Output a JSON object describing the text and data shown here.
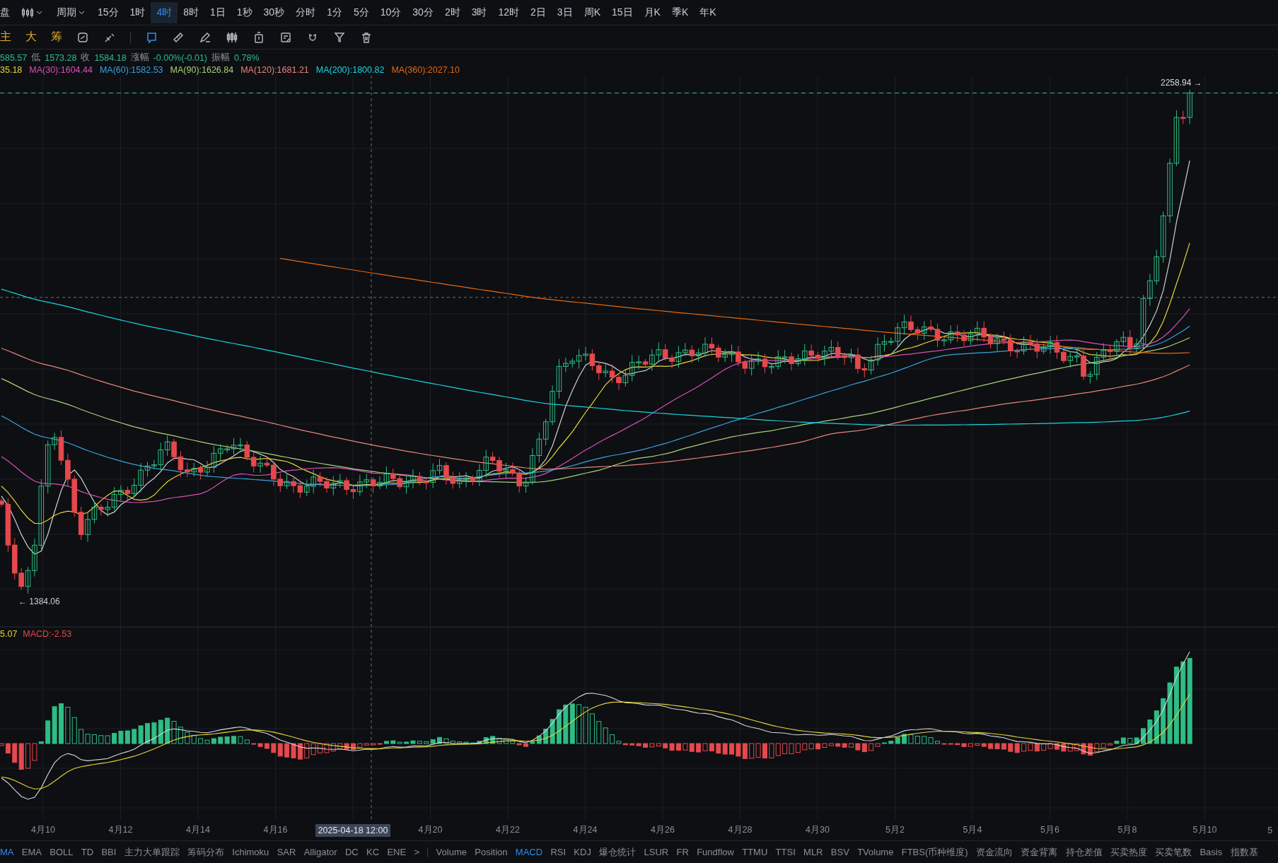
{
  "toolbar": {
    "cut_tab": "盘",
    "period_menu": "周期",
    "intervals": [
      {
        "label": "15分",
        "selected": false
      },
      {
        "label": "1时",
        "selected": false
      },
      {
        "label": "4时",
        "selected": true
      },
      {
        "label": "8时",
        "selected": false
      },
      {
        "label": "1日",
        "selected": false
      },
      {
        "label": "1秒",
        "selected": false
      },
      {
        "label": "30秒",
        "selected": false
      },
      {
        "label": "分时",
        "selected": false
      },
      {
        "label": "1分",
        "selected": false
      },
      {
        "label": "5分",
        "selected": false
      },
      {
        "label": "10分",
        "selected": false
      },
      {
        "label": "30分",
        "selected": false
      },
      {
        "label": "2时",
        "selected": false
      },
      {
        "label": "3时",
        "selected": false
      },
      {
        "label": "12时",
        "selected": false
      },
      {
        "label": "2日",
        "selected": false
      },
      {
        "label": "3日",
        "selected": false
      },
      {
        "label": "周K",
        "selected": false
      },
      {
        "label": "15日",
        "selected": false
      },
      {
        "label": "月K",
        "selected": false
      },
      {
        "label": "季K",
        "selected": false
      },
      {
        "label": "年K",
        "selected": false
      }
    ]
  },
  "chart_modes": [
    "主",
    "大",
    "筹"
  ],
  "ohlc_legend": [
    {
      "value": "585.57"
    },
    {
      "label": "低",
      "value": "1573.28"
    },
    {
      "label": "收",
      "value": "1584.18"
    },
    {
      "label": "涨幅",
      "value": "-0.00%(-0.01)"
    },
    {
      "label": "振幅",
      "value": "0.78%"
    }
  ],
  "ma_legend": [
    {
      "text": "35.18",
      "color": "#e8d33a"
    },
    {
      "text": "MA(30):1604.44",
      "color": "#d94fb8"
    },
    {
      "text": "MA(60):1582.53",
      "color": "#3ba0e0"
    },
    {
      "text": "MA(90):1626.84",
      "color": "#a8d27a"
    },
    {
      "text": "MA(120):1681.21",
      "color": "#e8847a"
    },
    {
      "text": "MA(200):1800.82",
      "color": "#19d3e0"
    },
    {
      "text": "MA(360):2027.10",
      "color": "#e6680f"
    }
  ],
  "price_labels": {
    "high": "2258.94 →",
    "low": "← 1384.06"
  },
  "macd_legend": [
    {
      "text": "5.07",
      "color": "#e8d33a"
    },
    {
      "text": "MACD:-2.53",
      "color": "#e5484d"
    }
  ],
  "x_axis": [
    {
      "label": "4月10",
      "kind": "date"
    },
    {
      "label": "4月12",
      "kind": "date"
    },
    {
      "label": "4月14",
      "kind": "date"
    },
    {
      "label": "4月16",
      "kind": "date"
    },
    {
      "label": "2025-04-18 12:00",
      "kind": "cursor"
    },
    {
      "label": "4月20",
      "kind": "date"
    },
    {
      "label": "4月22",
      "kind": "date"
    },
    {
      "label": "4月24",
      "kind": "date"
    },
    {
      "label": "4月26",
      "kind": "date"
    },
    {
      "label": "4月28",
      "kind": "date"
    },
    {
      "label": "4月30",
      "kind": "date"
    },
    {
      "label": "5月2",
      "kind": "date"
    },
    {
      "label": "5月4",
      "kind": "date"
    },
    {
      "label": "5月6",
      "kind": "date"
    },
    {
      "label": "5月8",
      "kind": "date"
    },
    {
      "label": "5月10",
      "kind": "date"
    },
    {
      "label": "5",
      "kind": "date"
    }
  ],
  "indicator_bar": {
    "main": [
      {
        "label": "MA",
        "selected": true
      },
      {
        "label": "EMA",
        "selected": false
      },
      {
        "label": "BOLL",
        "selected": false
      },
      {
        "label": "TD",
        "selected": false
      },
      {
        "label": "BBI",
        "selected": false
      },
      {
        "label": "主力大单跟踪",
        "selected": false
      },
      {
        "label": "筹码分布",
        "selected": false
      },
      {
        "label": "Ichimoku",
        "selected": false
      },
      {
        "label": "SAR",
        "selected": false
      },
      {
        "label": "Alligator",
        "selected": false
      },
      {
        "label": "DC",
        "selected": false
      },
      {
        "label": "KC",
        "selected": false
      },
      {
        "label": "ENE",
        "selected": false
      }
    ],
    "more": ">",
    "sub": [
      {
        "label": "Volume",
        "selected": false
      },
      {
        "label": "Position",
        "selected": false
      },
      {
        "label": "MACD",
        "selected": true
      },
      {
        "label": "RSI",
        "selected": false
      },
      {
        "label": "KDJ",
        "selected": false
      },
      {
        "label": "爆仓统计",
        "selected": false
      },
      {
        "label": "LSUR",
        "selected": false
      },
      {
        "label": "FR",
        "selected": false
      },
      {
        "label": "Fundflow",
        "selected": false
      },
      {
        "label": "TTMU",
        "selected": false
      },
      {
        "label": "TTSI",
        "selected": false
      },
      {
        "label": "MLR",
        "selected": false
      },
      {
        "label": "BSV",
        "selected": false
      },
      {
        "label": "TVolume",
        "selected": false
      },
      {
        "label": "FTBS(币种维度)",
        "selected": false
      },
      {
        "label": "资金流向",
        "selected": false
      },
      {
        "label": "资金背离",
        "selected": false
      },
      {
        "label": "持仓差值",
        "selected": false
      },
      {
        "label": "买卖热度",
        "selected": false
      },
      {
        "label": "买卖笔数",
        "selected": false
      },
      {
        "label": "Basis",
        "selected": false
      },
      {
        "label": "指数基",
        "selected": false
      }
    ]
  }
}
